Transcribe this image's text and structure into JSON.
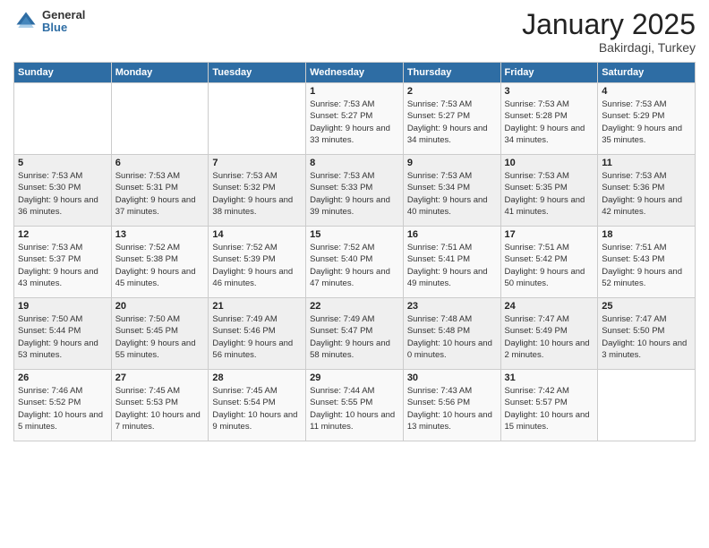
{
  "logo": {
    "general": "General",
    "blue": "Blue"
  },
  "header": {
    "month": "January 2025",
    "location": "Bakirdagi, Turkey"
  },
  "weekdays": [
    "Sunday",
    "Monday",
    "Tuesday",
    "Wednesday",
    "Thursday",
    "Friday",
    "Saturday"
  ],
  "weeks": [
    [
      {
        "day": "",
        "sunrise": "",
        "sunset": "",
        "daylight": ""
      },
      {
        "day": "",
        "sunrise": "",
        "sunset": "",
        "daylight": ""
      },
      {
        "day": "",
        "sunrise": "",
        "sunset": "",
        "daylight": ""
      },
      {
        "day": "1",
        "sunrise": "Sunrise: 7:53 AM",
        "sunset": "Sunset: 5:27 PM",
        "daylight": "Daylight: 9 hours and 33 minutes."
      },
      {
        "day": "2",
        "sunrise": "Sunrise: 7:53 AM",
        "sunset": "Sunset: 5:27 PM",
        "daylight": "Daylight: 9 hours and 34 minutes."
      },
      {
        "day": "3",
        "sunrise": "Sunrise: 7:53 AM",
        "sunset": "Sunset: 5:28 PM",
        "daylight": "Daylight: 9 hours and 34 minutes."
      },
      {
        "day": "4",
        "sunrise": "Sunrise: 7:53 AM",
        "sunset": "Sunset: 5:29 PM",
        "daylight": "Daylight: 9 hours and 35 minutes."
      }
    ],
    [
      {
        "day": "5",
        "sunrise": "Sunrise: 7:53 AM",
        "sunset": "Sunset: 5:30 PM",
        "daylight": "Daylight: 9 hours and 36 minutes."
      },
      {
        "day": "6",
        "sunrise": "Sunrise: 7:53 AM",
        "sunset": "Sunset: 5:31 PM",
        "daylight": "Daylight: 9 hours and 37 minutes."
      },
      {
        "day": "7",
        "sunrise": "Sunrise: 7:53 AM",
        "sunset": "Sunset: 5:32 PM",
        "daylight": "Daylight: 9 hours and 38 minutes."
      },
      {
        "day": "8",
        "sunrise": "Sunrise: 7:53 AM",
        "sunset": "Sunset: 5:33 PM",
        "daylight": "Daylight: 9 hours and 39 minutes."
      },
      {
        "day": "9",
        "sunrise": "Sunrise: 7:53 AM",
        "sunset": "Sunset: 5:34 PM",
        "daylight": "Daylight: 9 hours and 40 minutes."
      },
      {
        "day": "10",
        "sunrise": "Sunrise: 7:53 AM",
        "sunset": "Sunset: 5:35 PM",
        "daylight": "Daylight: 9 hours and 41 minutes."
      },
      {
        "day": "11",
        "sunrise": "Sunrise: 7:53 AM",
        "sunset": "Sunset: 5:36 PM",
        "daylight": "Daylight: 9 hours and 42 minutes."
      }
    ],
    [
      {
        "day": "12",
        "sunrise": "Sunrise: 7:53 AM",
        "sunset": "Sunset: 5:37 PM",
        "daylight": "Daylight: 9 hours and 43 minutes."
      },
      {
        "day": "13",
        "sunrise": "Sunrise: 7:52 AM",
        "sunset": "Sunset: 5:38 PM",
        "daylight": "Daylight: 9 hours and 45 minutes."
      },
      {
        "day": "14",
        "sunrise": "Sunrise: 7:52 AM",
        "sunset": "Sunset: 5:39 PM",
        "daylight": "Daylight: 9 hours and 46 minutes."
      },
      {
        "day": "15",
        "sunrise": "Sunrise: 7:52 AM",
        "sunset": "Sunset: 5:40 PM",
        "daylight": "Daylight: 9 hours and 47 minutes."
      },
      {
        "day": "16",
        "sunrise": "Sunrise: 7:51 AM",
        "sunset": "Sunset: 5:41 PM",
        "daylight": "Daylight: 9 hours and 49 minutes."
      },
      {
        "day": "17",
        "sunrise": "Sunrise: 7:51 AM",
        "sunset": "Sunset: 5:42 PM",
        "daylight": "Daylight: 9 hours and 50 minutes."
      },
      {
        "day": "18",
        "sunrise": "Sunrise: 7:51 AM",
        "sunset": "Sunset: 5:43 PM",
        "daylight": "Daylight: 9 hours and 52 minutes."
      }
    ],
    [
      {
        "day": "19",
        "sunrise": "Sunrise: 7:50 AM",
        "sunset": "Sunset: 5:44 PM",
        "daylight": "Daylight: 9 hours and 53 minutes."
      },
      {
        "day": "20",
        "sunrise": "Sunrise: 7:50 AM",
        "sunset": "Sunset: 5:45 PM",
        "daylight": "Daylight: 9 hours and 55 minutes."
      },
      {
        "day": "21",
        "sunrise": "Sunrise: 7:49 AM",
        "sunset": "Sunset: 5:46 PM",
        "daylight": "Daylight: 9 hours and 56 minutes."
      },
      {
        "day": "22",
        "sunrise": "Sunrise: 7:49 AM",
        "sunset": "Sunset: 5:47 PM",
        "daylight": "Daylight: 9 hours and 58 minutes."
      },
      {
        "day": "23",
        "sunrise": "Sunrise: 7:48 AM",
        "sunset": "Sunset: 5:48 PM",
        "daylight": "Daylight: 10 hours and 0 minutes."
      },
      {
        "day": "24",
        "sunrise": "Sunrise: 7:47 AM",
        "sunset": "Sunset: 5:49 PM",
        "daylight": "Daylight: 10 hours and 2 minutes."
      },
      {
        "day": "25",
        "sunrise": "Sunrise: 7:47 AM",
        "sunset": "Sunset: 5:50 PM",
        "daylight": "Daylight: 10 hours and 3 minutes."
      }
    ],
    [
      {
        "day": "26",
        "sunrise": "Sunrise: 7:46 AM",
        "sunset": "Sunset: 5:52 PM",
        "daylight": "Daylight: 10 hours and 5 minutes."
      },
      {
        "day": "27",
        "sunrise": "Sunrise: 7:45 AM",
        "sunset": "Sunset: 5:53 PM",
        "daylight": "Daylight: 10 hours and 7 minutes."
      },
      {
        "day": "28",
        "sunrise": "Sunrise: 7:45 AM",
        "sunset": "Sunset: 5:54 PM",
        "daylight": "Daylight: 10 hours and 9 minutes."
      },
      {
        "day": "29",
        "sunrise": "Sunrise: 7:44 AM",
        "sunset": "Sunset: 5:55 PM",
        "daylight": "Daylight: 10 hours and 11 minutes."
      },
      {
        "day": "30",
        "sunrise": "Sunrise: 7:43 AM",
        "sunset": "Sunset: 5:56 PM",
        "daylight": "Daylight: 10 hours and 13 minutes."
      },
      {
        "day": "31",
        "sunrise": "Sunrise: 7:42 AM",
        "sunset": "Sunset: 5:57 PM",
        "daylight": "Daylight: 10 hours and 15 minutes."
      },
      {
        "day": "",
        "sunrise": "",
        "sunset": "",
        "daylight": ""
      }
    ]
  ]
}
